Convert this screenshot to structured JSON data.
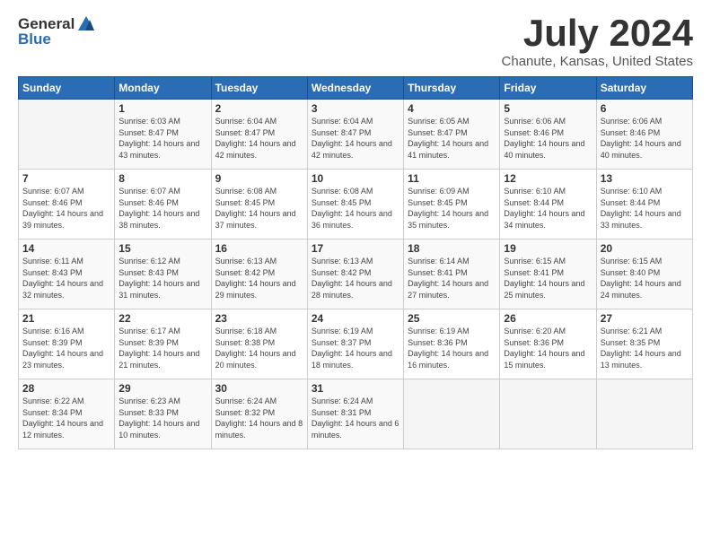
{
  "logo": {
    "general": "General",
    "blue": "Blue"
  },
  "title": "July 2024",
  "subtitle": "Chanute, Kansas, United States",
  "days_of_week": [
    "Sunday",
    "Monday",
    "Tuesday",
    "Wednesday",
    "Thursday",
    "Friday",
    "Saturday"
  ],
  "weeks": [
    [
      {
        "day": "",
        "sunrise": "",
        "sunset": "",
        "daylight": ""
      },
      {
        "day": "1",
        "sunrise": "Sunrise: 6:03 AM",
        "sunset": "Sunset: 8:47 PM",
        "daylight": "Daylight: 14 hours and 43 minutes."
      },
      {
        "day": "2",
        "sunrise": "Sunrise: 6:04 AM",
        "sunset": "Sunset: 8:47 PM",
        "daylight": "Daylight: 14 hours and 42 minutes."
      },
      {
        "day": "3",
        "sunrise": "Sunrise: 6:04 AM",
        "sunset": "Sunset: 8:47 PM",
        "daylight": "Daylight: 14 hours and 42 minutes."
      },
      {
        "day": "4",
        "sunrise": "Sunrise: 6:05 AM",
        "sunset": "Sunset: 8:47 PM",
        "daylight": "Daylight: 14 hours and 41 minutes."
      },
      {
        "day": "5",
        "sunrise": "Sunrise: 6:06 AM",
        "sunset": "Sunset: 8:46 PM",
        "daylight": "Daylight: 14 hours and 40 minutes."
      },
      {
        "day": "6",
        "sunrise": "Sunrise: 6:06 AM",
        "sunset": "Sunset: 8:46 PM",
        "daylight": "Daylight: 14 hours and 40 minutes."
      }
    ],
    [
      {
        "day": "7",
        "sunrise": "Sunrise: 6:07 AM",
        "sunset": "Sunset: 8:46 PM",
        "daylight": "Daylight: 14 hours and 39 minutes."
      },
      {
        "day": "8",
        "sunrise": "Sunrise: 6:07 AM",
        "sunset": "Sunset: 8:46 PM",
        "daylight": "Daylight: 14 hours and 38 minutes."
      },
      {
        "day": "9",
        "sunrise": "Sunrise: 6:08 AM",
        "sunset": "Sunset: 8:45 PM",
        "daylight": "Daylight: 14 hours and 37 minutes."
      },
      {
        "day": "10",
        "sunrise": "Sunrise: 6:08 AM",
        "sunset": "Sunset: 8:45 PM",
        "daylight": "Daylight: 14 hours and 36 minutes."
      },
      {
        "day": "11",
        "sunrise": "Sunrise: 6:09 AM",
        "sunset": "Sunset: 8:45 PM",
        "daylight": "Daylight: 14 hours and 35 minutes."
      },
      {
        "day": "12",
        "sunrise": "Sunrise: 6:10 AM",
        "sunset": "Sunset: 8:44 PM",
        "daylight": "Daylight: 14 hours and 34 minutes."
      },
      {
        "day": "13",
        "sunrise": "Sunrise: 6:10 AM",
        "sunset": "Sunset: 8:44 PM",
        "daylight": "Daylight: 14 hours and 33 minutes."
      }
    ],
    [
      {
        "day": "14",
        "sunrise": "Sunrise: 6:11 AM",
        "sunset": "Sunset: 8:43 PM",
        "daylight": "Daylight: 14 hours and 32 minutes."
      },
      {
        "day": "15",
        "sunrise": "Sunrise: 6:12 AM",
        "sunset": "Sunset: 8:43 PM",
        "daylight": "Daylight: 14 hours and 31 minutes."
      },
      {
        "day": "16",
        "sunrise": "Sunrise: 6:13 AM",
        "sunset": "Sunset: 8:42 PM",
        "daylight": "Daylight: 14 hours and 29 minutes."
      },
      {
        "day": "17",
        "sunrise": "Sunrise: 6:13 AM",
        "sunset": "Sunset: 8:42 PM",
        "daylight": "Daylight: 14 hours and 28 minutes."
      },
      {
        "day": "18",
        "sunrise": "Sunrise: 6:14 AM",
        "sunset": "Sunset: 8:41 PM",
        "daylight": "Daylight: 14 hours and 27 minutes."
      },
      {
        "day": "19",
        "sunrise": "Sunrise: 6:15 AM",
        "sunset": "Sunset: 8:41 PM",
        "daylight": "Daylight: 14 hours and 25 minutes."
      },
      {
        "day": "20",
        "sunrise": "Sunrise: 6:15 AM",
        "sunset": "Sunset: 8:40 PM",
        "daylight": "Daylight: 14 hours and 24 minutes."
      }
    ],
    [
      {
        "day": "21",
        "sunrise": "Sunrise: 6:16 AM",
        "sunset": "Sunset: 8:39 PM",
        "daylight": "Daylight: 14 hours and 23 minutes."
      },
      {
        "day": "22",
        "sunrise": "Sunrise: 6:17 AM",
        "sunset": "Sunset: 8:39 PM",
        "daylight": "Daylight: 14 hours and 21 minutes."
      },
      {
        "day": "23",
        "sunrise": "Sunrise: 6:18 AM",
        "sunset": "Sunset: 8:38 PM",
        "daylight": "Daylight: 14 hours and 20 minutes."
      },
      {
        "day": "24",
        "sunrise": "Sunrise: 6:19 AM",
        "sunset": "Sunset: 8:37 PM",
        "daylight": "Daylight: 14 hours and 18 minutes."
      },
      {
        "day": "25",
        "sunrise": "Sunrise: 6:19 AM",
        "sunset": "Sunset: 8:36 PM",
        "daylight": "Daylight: 14 hours and 16 minutes."
      },
      {
        "day": "26",
        "sunrise": "Sunrise: 6:20 AM",
        "sunset": "Sunset: 8:36 PM",
        "daylight": "Daylight: 14 hours and 15 minutes."
      },
      {
        "day": "27",
        "sunrise": "Sunrise: 6:21 AM",
        "sunset": "Sunset: 8:35 PM",
        "daylight": "Daylight: 14 hours and 13 minutes."
      }
    ],
    [
      {
        "day": "28",
        "sunrise": "Sunrise: 6:22 AM",
        "sunset": "Sunset: 8:34 PM",
        "daylight": "Daylight: 14 hours and 12 minutes."
      },
      {
        "day": "29",
        "sunrise": "Sunrise: 6:23 AM",
        "sunset": "Sunset: 8:33 PM",
        "daylight": "Daylight: 14 hours and 10 minutes."
      },
      {
        "day": "30",
        "sunrise": "Sunrise: 6:24 AM",
        "sunset": "Sunset: 8:32 PM",
        "daylight": "Daylight: 14 hours and 8 minutes."
      },
      {
        "day": "31",
        "sunrise": "Sunrise: 6:24 AM",
        "sunset": "Sunset: 8:31 PM",
        "daylight": "Daylight: 14 hours and 6 minutes."
      },
      {
        "day": "",
        "sunrise": "",
        "sunset": "",
        "daylight": ""
      },
      {
        "day": "",
        "sunrise": "",
        "sunset": "",
        "daylight": ""
      },
      {
        "day": "",
        "sunrise": "",
        "sunset": "",
        "daylight": ""
      }
    ]
  ]
}
